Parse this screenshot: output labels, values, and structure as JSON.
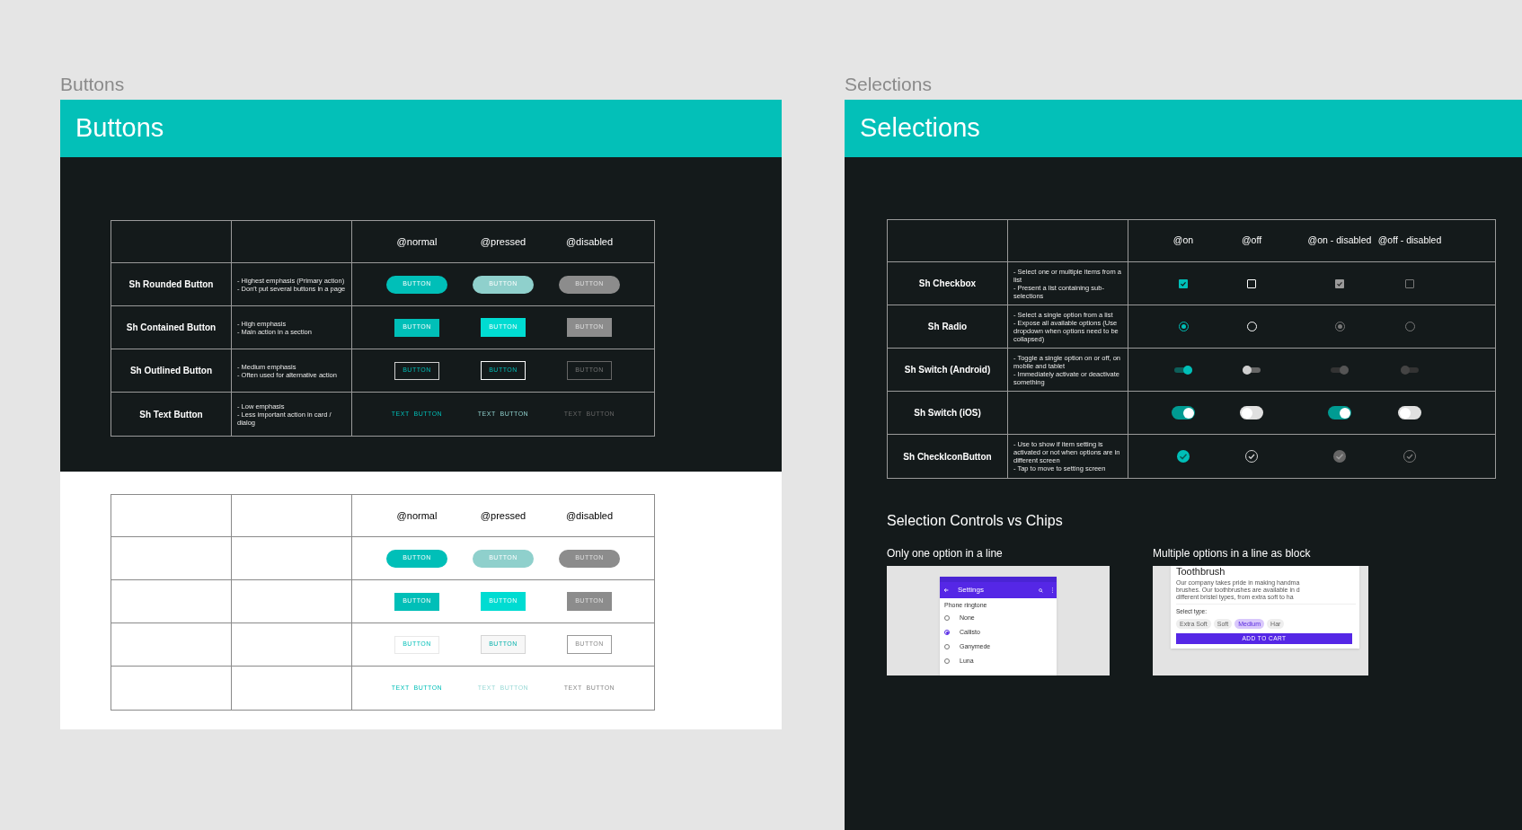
{
  "buttons_frame": {
    "label": "Buttons",
    "title": "Buttons",
    "dark_table": {
      "columns": [
        "@normal",
        "@pressed",
        "@disabled"
      ],
      "rows": [
        {
          "name": "Sh Rounded Button",
          "kind": "rounded",
          "notes": [
            "- Highest emphasis (Primary action)",
            "- Don't put several buttons in a page"
          ],
          "buttons": [
            {
              "label": "BUTTON",
              "pressed": false,
              "disabled": false
            },
            {
              "label": "BUTTON",
              "pressed": true,
              "disabled": false
            },
            {
              "label": "BUTTON",
              "pressed": false,
              "disabled": true
            }
          ]
        },
        {
          "name": "Sh Contained Button",
          "kind": "contained",
          "notes": [
            "- High emphasis",
            "- Main action in a section"
          ],
          "buttons": [
            {
              "label": "BUTTON",
              "pressed": false,
              "disabled": false
            },
            {
              "label": "BUTTON",
              "pressed": true,
              "disabled": false
            },
            {
              "label": "BUTTON",
              "pressed": false,
              "disabled": true
            }
          ]
        },
        {
          "name": "Sh Outlined Button",
          "kind": "outlined",
          "notes": [
            "- Medium emphasis",
            "- Often used for alternative action"
          ],
          "buttons": [
            {
              "label": "BUTTON",
              "pressed": false,
              "disabled": false
            },
            {
              "label": "BUTTON",
              "pressed": true,
              "disabled": false
            },
            {
              "label": "BUTTON",
              "pressed": false,
              "disabled": true
            }
          ]
        },
        {
          "name": "Sh Text Button",
          "kind": "text",
          "notes": [
            "- Low emphasis",
            "- Less important action in card / dialog"
          ],
          "buttons": [
            {
              "label": "TEXT  BUTTON",
              "pressed": false,
              "disabled": false
            },
            {
              "label": "TEXT  BUTTON",
              "pressed": true,
              "disabled": false
            },
            {
              "label": "TEXT  BUTTON",
              "pressed": false,
              "disabled": true
            }
          ]
        }
      ]
    },
    "light_table": {
      "columns": [
        "@normal",
        "@pressed",
        "@disabled"
      ],
      "rows": [
        {
          "kind": "rounded",
          "buttons": [
            {
              "label": "BUTTON",
              "pressed": false,
              "disabled": false
            },
            {
              "label": "BUTTON",
              "pressed": true,
              "disabled": false
            },
            {
              "label": "BUTTON",
              "pressed": false,
              "disabled": true
            }
          ]
        },
        {
          "kind": "contained",
          "buttons": [
            {
              "label": "BUTTON",
              "pressed": false,
              "disabled": false
            },
            {
              "label": "BUTTON",
              "pressed": true,
              "disabled": false
            },
            {
              "label": "BUTTON",
              "pressed": false,
              "disabled": true
            }
          ]
        },
        {
          "kind": "outlined",
          "buttons": [
            {
              "label": "BUTTON",
              "pressed": false,
              "disabled": false
            },
            {
              "label": "BUTTON",
              "pressed": true,
              "disabled": false
            },
            {
              "label": "BUTTON",
              "pressed": false,
              "disabled": true
            }
          ]
        },
        {
          "kind": "text",
          "buttons": [
            {
              "label": "TEXT  BUTTON",
              "pressed": false,
              "disabled": false
            },
            {
              "label": "TEXT  BUTTON",
              "pressed": true,
              "disabled": false
            },
            {
              "label": "TEXT  BUTTON",
              "pressed": false,
              "disabled": true
            }
          ]
        }
      ]
    }
  },
  "selections_frame": {
    "label": "Selections",
    "title": "Selections",
    "columns": [
      {
        "label": "@on",
        "on": true,
        "disabled": false
      },
      {
        "label": "@off",
        "on": false,
        "disabled": false
      },
      {
        "label": "@on - disabled",
        "on": true,
        "disabled": true
      },
      {
        "label": "@off - disabled",
        "on": false,
        "disabled": true
      }
    ],
    "rows": [
      {
        "name": "Sh Checkbox",
        "kind": "checkbox",
        "notes": [
          "- Select one or multiple items from a list",
          "- Present a list containing sub-selections"
        ]
      },
      {
        "name": "Sh Radio",
        "kind": "radio",
        "notes": [
          "- Select a single option from a list",
          "- Expose all available options (Use dropdown when options need to be collapsed)"
        ]
      },
      {
        "name": "Sh Switch (Android)",
        "kind": "android_switch",
        "notes": [
          "- Toggle a single option on or off, on mobile and tablet",
          "- Immediately activate or deactivate something"
        ]
      },
      {
        "name": "Sh Switch (iOS)",
        "kind": "ios_switch",
        "notes": []
      },
      {
        "name": "Sh CheckIconButton",
        "kind": "check_icon",
        "notes": [
          "- Use to show if item setting is activated or not when options are in different screen",
          "- Tap to move to setting screen"
        ]
      }
    ],
    "section_title": "Selection Controls vs Chips",
    "examples": [
      {
        "kind": "radio_list",
        "caption": "Only one option in a line",
        "app_title": "Settings",
        "list_title": "Phone ringtone",
        "options": [
          {
            "label": "None",
            "selected": false
          },
          {
            "label": "Callisto",
            "selected": true
          },
          {
            "label": "Ganymede",
            "selected": false
          },
          {
            "label": "Luna",
            "selected": false
          }
        ]
      },
      {
        "kind": "chips",
        "caption": "Multiple options in a line as block",
        "card_title": "Toothbrush",
        "description": [
          "Our company takes pride in making handma",
          "brushes. Our toothbrushes are available in d",
          "different bristel types, from extra soft to ha"
        ],
        "select_label": "Select type:",
        "chips": [
          {
            "label": "Extra Soft",
            "selected": false
          },
          {
            "label": "Soft",
            "selected": false
          },
          {
            "label": "Medium",
            "selected": true
          },
          {
            "label": "Har",
            "selected": false
          }
        ],
        "action": "ADD TO CART"
      }
    ]
  }
}
